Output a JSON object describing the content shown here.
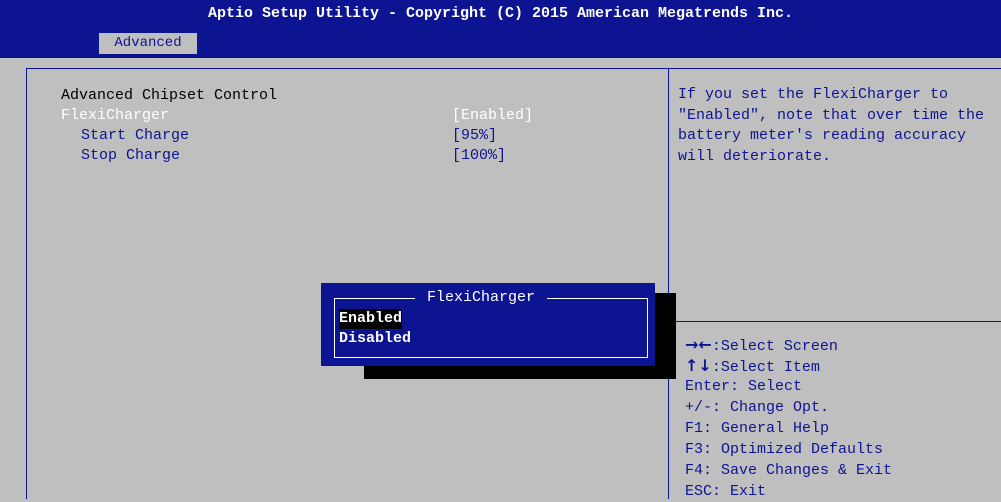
{
  "header": {
    "title": "Aptio Setup Utility - Copyright (C) 2015 American Megatrends Inc.",
    "tab": "Advanced"
  },
  "main": {
    "section_title": "Advanced Chipset Control",
    "settings": [
      {
        "label": "FlexiCharger",
        "value": "[Enabled]"
      },
      {
        "label": "Start Charge",
        "value": "[95%]"
      },
      {
        "label": "Stop Charge",
        "value": "[100%]"
      }
    ]
  },
  "help": {
    "text": "If you set the FlexiCharger to \"Enabled\", note that over time the battery meter's reading accuracy will deteriorate."
  },
  "keys": [
    {
      "icon": "left-right-arrows-icon",
      "glyph": "→←",
      "text": ":Select Screen"
    },
    {
      "icon": "up-down-arrows-icon",
      "glyph": "↑↓",
      "text": ":Select Item"
    },
    {
      "icon": "",
      "glyph": "",
      "text": "Enter: Select"
    },
    {
      "icon": "",
      "glyph": "",
      "text": "+/-: Change Opt."
    },
    {
      "icon": "",
      "glyph": "",
      "text": "F1: General Help"
    },
    {
      "icon": "",
      "glyph": "",
      "text": "F3: Optimized Defaults"
    },
    {
      "icon": "",
      "glyph": "",
      "text": "F4: Save Changes & Exit"
    },
    {
      "icon": "",
      "glyph": "",
      "text": "ESC: Exit"
    }
  ],
  "popup": {
    "title": "FlexiCharger",
    "options": [
      "Enabled",
      "Disabled"
    ],
    "selected": "Enabled"
  },
  "colors": {
    "bios_blue": "#0d1491",
    "background_gray": "#bfbfbf",
    "highlight_white": "#ffffff"
  }
}
